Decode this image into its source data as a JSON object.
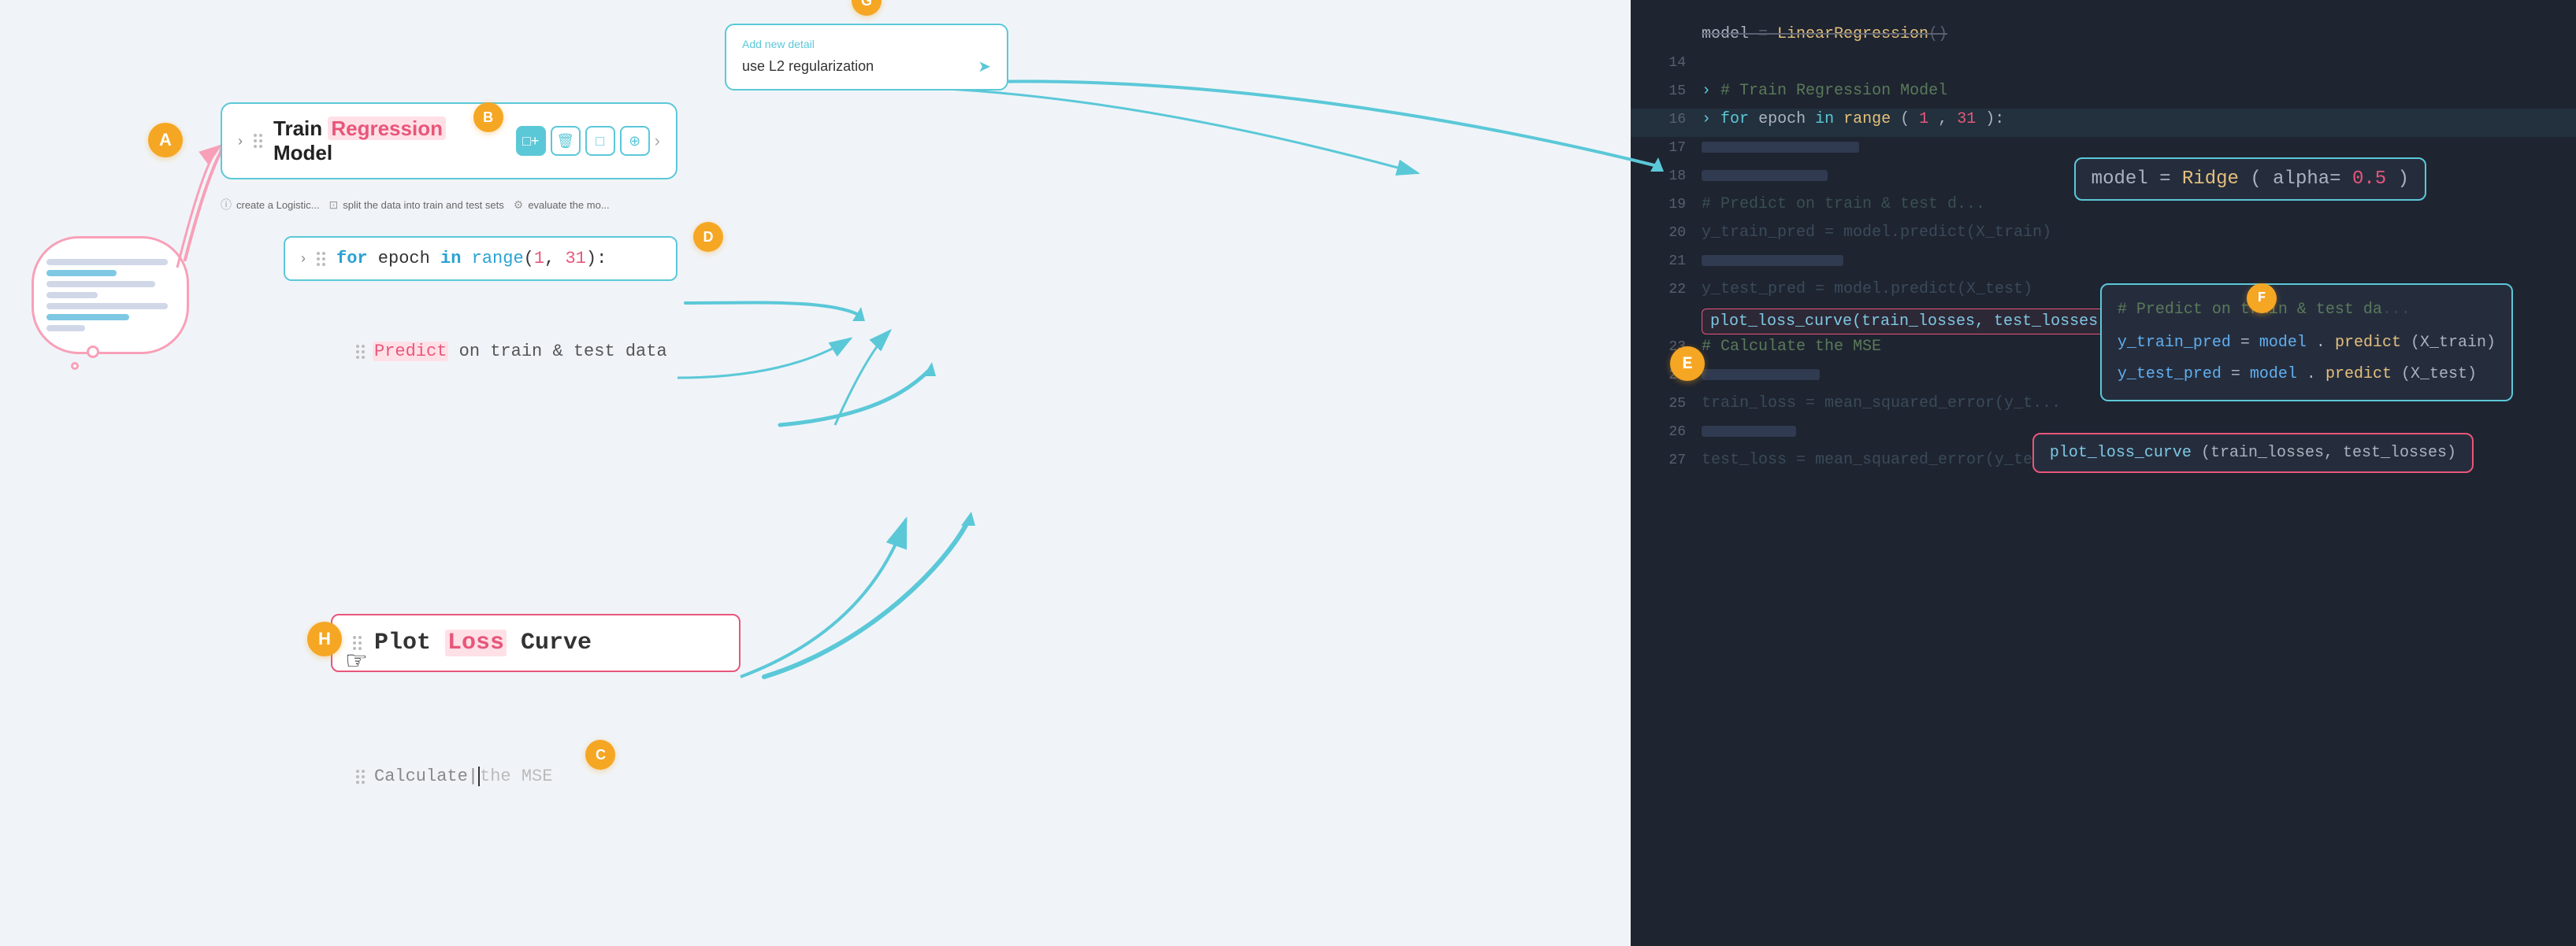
{
  "labels": {
    "A": "A",
    "B": "B",
    "C": "C",
    "D": "D",
    "E": "E",
    "F": "F",
    "G": "G",
    "H": "H"
  },
  "thought_cloud": {
    "aria": "thought-cloud-concept"
  },
  "train_model": {
    "chevron": "›",
    "title_prefix": "Train ",
    "title_highlight": "Regression",
    "title_suffix": " Model"
  },
  "toolbar": {
    "buttons": [
      "□+",
      "🗑",
      "□",
      "⊕",
      "›"
    ]
  },
  "sub_items": {
    "items": [
      {
        "icon": "ⓘ",
        "text": "create a Logistic..."
      },
      {
        "icon": "⊡",
        "text": "split the data into train and test sets"
      },
      {
        "icon": "⚙",
        "text": "evaluate the mo..."
      }
    ]
  },
  "for_epoch": {
    "text": "for epoch in range(1, 31):"
  },
  "predict_block": {
    "text": "Predict on train & test data"
  },
  "plot_loss": {
    "text": "Plot Loss Curve"
  },
  "calculate_mse": {
    "text": "Calculate",
    "text2": "the MSE"
  },
  "add_detail_popup": {
    "label": "Add new detail",
    "value": "use L2 regularization",
    "placeholder": "Add new detail...",
    "send_icon": "➤"
  },
  "code_panel": {
    "lines": [
      {
        "num": "",
        "content": "model = LinearRegression()",
        "type": "strikethrough"
      },
      {
        "num": "14",
        "content": "",
        "type": "normal"
      },
      {
        "num": "15",
        "content": "# Train Regression Model",
        "type": "comment"
      },
      {
        "num": "16",
        "content": "for epoch in range(1, 31):",
        "type": "normal"
      },
      {
        "num": "17",
        "content": "",
        "type": "normal"
      },
      {
        "num": "18",
        "content": "",
        "type": "normal"
      },
      {
        "num": "19",
        "content": "    # Predict on train & test d...",
        "type": "comment-fade"
      },
      {
        "num": "20",
        "content": "    y_train_pred = model.predict(X_train)",
        "type": "normal"
      },
      {
        "num": "21",
        "content": "",
        "type": "normal"
      },
      {
        "num": "22",
        "content": "    y_test_pred = model.predict(X_test)",
        "type": "normal"
      },
      {
        "num": "",
        "content": "    plot_loss_curve(train_losses, test_losses)",
        "type": "plot-highlight"
      },
      {
        "num": "23",
        "content": "    # Calculate the MSE",
        "type": "comment"
      },
      {
        "num": "24",
        "content": "",
        "type": "normal"
      },
      {
        "num": "25",
        "content": "    train_loss = mean_squared_error(y_t...",
        "type": "fade"
      },
      {
        "num": "26",
        "content": "",
        "type": "normal"
      },
      {
        "num": "27",
        "content": "    test_loss = mean_squared_error(y_te...",
        "type": "fade"
      }
    ],
    "ridge_callout": "model = Ridge(alpha=0.5)",
    "predict_callout_1": "# Predict on train & test da...",
    "predict_callout_2": "y_train_pred = model.predict(X_train)",
    "predict_callout_3": "y_test_pred = model.predict(X_test)",
    "plot_callout": "plot_loss_curve(train_losses, test_losses)"
  },
  "colors": {
    "orange": "#f5a623",
    "teal": "#5bc8d8",
    "pink": "#e8567a",
    "pinkbg": "#ffe0e6",
    "codebg": "#1e2430",
    "calloutbg": "#252d3d"
  }
}
